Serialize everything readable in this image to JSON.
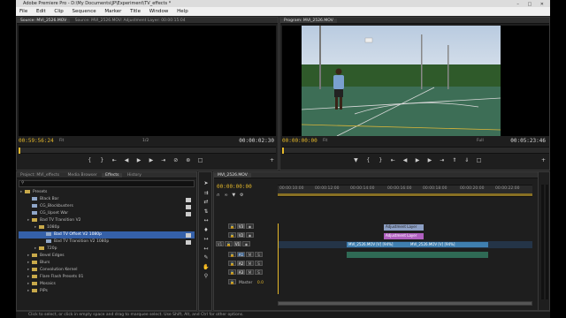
{
  "titlebar": {
    "title": "Adobe Premiere Pro - D:\\My Documents\\JP\\Experiment\\TV_effects *"
  },
  "menu": [
    "File",
    "Edit",
    "Clip",
    "Sequence",
    "Marker",
    "Title",
    "Window",
    "Help"
  ],
  "source": {
    "tabs": [
      "Source: MVI_2526.MOV",
      "Source: MVI_2526.MOV: Adjustment Layer: 00:00:15:04"
    ],
    "tc_left": "00:59:56:24",
    "fit": "Fit",
    "ratio": "1/2",
    "tc_right": "00:00:02:30"
  },
  "program": {
    "tab": "Program: MVI_2526.MOV",
    "tc_left": "00:00:00:00",
    "fit": "Fit",
    "ratio": "Full",
    "tc_right": "00:05:23:46"
  },
  "effects": {
    "tabs": [
      "Project: MVI_effects",
      "Media Browser",
      "Effects",
      "History"
    ],
    "items": [
      {
        "label": "Presets",
        "level": 0,
        "type": "folder"
      },
      {
        "label": "Black Bar",
        "level": 1,
        "type": "item",
        "badge": true
      },
      {
        "label": "CG_Blockbusters",
        "level": 1,
        "type": "item",
        "badge": true
      },
      {
        "label": "CG_Upset War",
        "level": 1,
        "type": "item",
        "badge": true
      },
      {
        "label": "Bad TV Transition V2",
        "level": 1,
        "type": "folder"
      },
      {
        "label": "1080p",
        "level": 2,
        "type": "folder"
      },
      {
        "label": "Bad TV Offset V2 1080p",
        "level": 3,
        "type": "item",
        "selected": true,
        "badge": true
      },
      {
        "label": "Bad TV Transition V2 1080p",
        "level": 3,
        "type": "item",
        "badge": true
      },
      {
        "label": "720p",
        "level": 2,
        "type": "folder"
      },
      {
        "label": "Bevel Edges",
        "level": 1,
        "type": "folder"
      },
      {
        "label": "Blurs",
        "level": 1,
        "type": "folder"
      },
      {
        "label": "Convolution Kernel",
        "level": 1,
        "type": "folder"
      },
      {
        "label": "Flare Flash Presets 01",
        "level": 1,
        "type": "folder"
      },
      {
        "label": "Mosaics",
        "level": 1,
        "type": "folder"
      },
      {
        "label": "PiPs",
        "level": 1,
        "type": "folder"
      }
    ]
  },
  "timeline": {
    "tab": "MVI_2526.MOV",
    "timecode": "00:00:00:00",
    "ruler": [
      "00:00:10:00",
      "00:00:12:00",
      "00:00:14:00",
      "00:00:16:00",
      "00:00:18:00",
      "00:00:20:00",
      "00:00:22:00"
    ],
    "video_tracks": [
      "V3",
      "V2",
      "V1"
    ],
    "audio_tracks": [
      "A1",
      "A2",
      "A3"
    ],
    "master_label": "Master",
    "master_value": "0.0",
    "source_patch": "V1",
    "clips": {
      "adj1": "Adjustment Layer",
      "adj2": "Adjustment Layer",
      "v1a": "MVI_2526.MOV [V] [94%]",
      "v1b": "MVI_2526.MOV [V] [94%]"
    }
  },
  "status": {
    "text": "Click to select, or click in empty space and drag to marquee select. Use Shift, Alt, and Ctrl for other options."
  },
  "colors": {
    "accent": "#3560a8",
    "timecode": "#e5b82a",
    "adjustment": "#b060c0",
    "v1": "#3f7fb0"
  }
}
